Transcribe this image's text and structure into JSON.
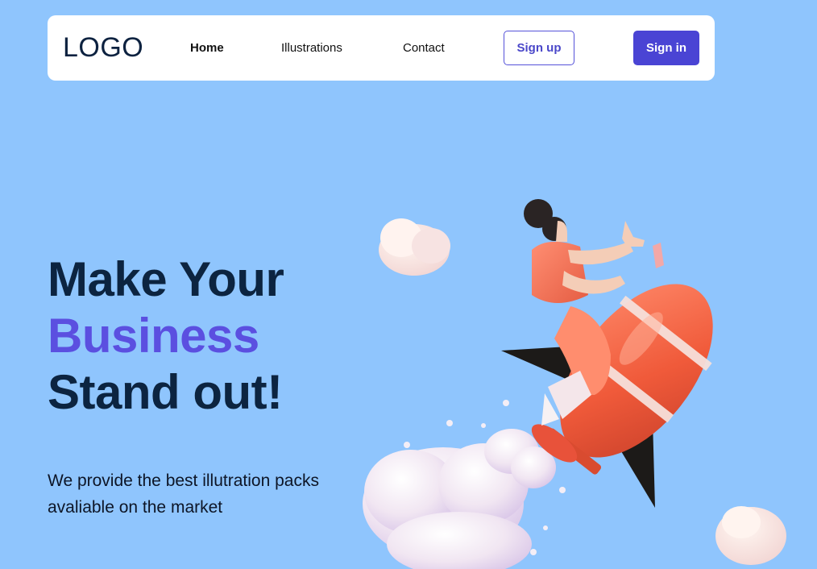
{
  "nav": {
    "logo": "LOGO",
    "links": [
      {
        "label": "Home",
        "active": true
      },
      {
        "label": "Illustrations",
        "active": false
      },
      {
        "label": "Contact",
        "active": false
      }
    ],
    "signup_label": "Sign up",
    "signin_label": "Sign in"
  },
  "hero": {
    "title_line1": "Make Your",
    "title_line2": "Business",
    "title_line3": "Stand out!",
    "description": "We provide the best illutration packs avaliable on the market"
  },
  "colors": {
    "background": "#8fc5fd",
    "accent": "#5b4fe0",
    "primary_button": "#4a44d4",
    "text_dark": "#0c2440"
  },
  "illustration": {
    "icon": "woman-riding-rocket-illustration"
  }
}
